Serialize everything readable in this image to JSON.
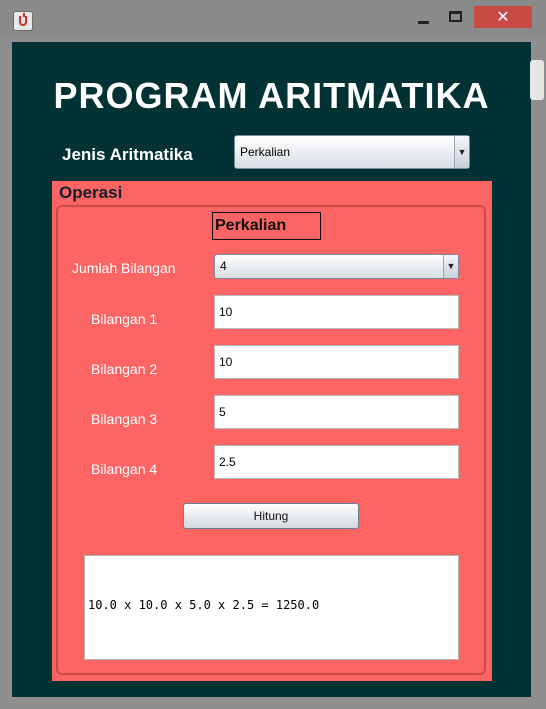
{
  "window": {
    "close_glyph": "✕"
  },
  "app": {
    "title": "PROGRAM ARITMATIKA",
    "jenis_label": "Jenis Aritmatika",
    "jenis_selected": "Perkalian"
  },
  "operasi": {
    "title": "Operasi",
    "operation_name": "Perkalian",
    "jumlah_label": "Jumlah Bilangan",
    "jumlah_selected": "4",
    "fields": [
      {
        "label": "Bilangan 1",
        "value": "10"
      },
      {
        "label": "Bilangan 2",
        "value": "10"
      },
      {
        "label": "Bilangan 3",
        "value": "5"
      },
      {
        "label": "Bilangan 4",
        "value": "2.5"
      }
    ],
    "button_label": "Hitung",
    "result": "10.0 x 10.0 x 5.0 x 2.5 = 1250.0"
  },
  "colors": {
    "background": "#023233",
    "panel": "#fd6464",
    "close_button": "#c74a44"
  },
  "icons": {
    "app": "java-icon",
    "dropdown": "triangle-down"
  }
}
